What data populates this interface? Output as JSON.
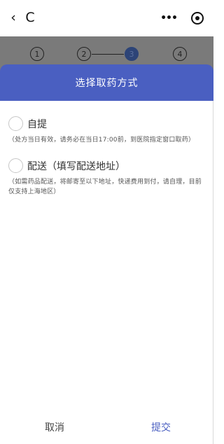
{
  "nav": {
    "back_icon": "chevron-left-icon",
    "back_glyph": "‹",
    "refresh_icon": "refresh-icon",
    "refresh_glyph": "C",
    "more_glyph": "•••"
  },
  "steps": [
    "1",
    "2",
    "3",
    "4"
  ],
  "active_step": 3,
  "sheet": {
    "title": "选择取药方式",
    "options": [
      {
        "label": "自提",
        "note": "（处方当日有效，请务必在当日17:00前，到医院指定窗口取药）"
      },
      {
        "label": "配送（填写配送地址）",
        "note": "（如需药品配送，将邮寄至以下地址，快递费用到付，请自理，目前仅支持上海地区）"
      }
    ]
  },
  "buttons": {
    "cancel": "取消",
    "submit": "提交"
  },
  "colors": {
    "header": "#4a5fc1",
    "submit": "#4a5fc1",
    "active_step": "#2d4477",
    "dim": "#7a7a7a"
  }
}
